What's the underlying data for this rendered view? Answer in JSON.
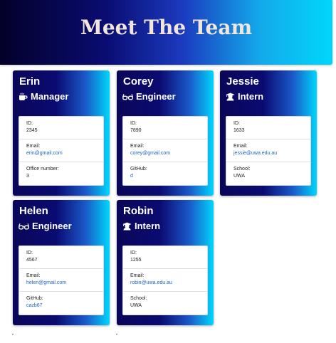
{
  "header": {
    "title": "Meet The Team"
  },
  "team": [
    {
      "name": "Erin",
      "role": "Manager",
      "role_icon": "coffee-icon",
      "rows": [
        {
          "label": "ID:",
          "value": "2345",
          "link": false
        },
        {
          "label": "Email:",
          "value": "erin@gmail.com",
          "link": true
        },
        {
          "label": "Office number:",
          "value": "3",
          "link": false
        }
      ]
    },
    {
      "name": "Corey",
      "role": "Engineer",
      "role_icon": "glasses-icon",
      "rows": [
        {
          "label": "ID:",
          "value": "7890",
          "link": false
        },
        {
          "label": "Email:",
          "value": "corey@gmail.com",
          "link": true
        },
        {
          "label": "GitHub:",
          "value": "d",
          "link": true
        }
      ]
    },
    {
      "name": "Jessie",
      "role": "Intern",
      "role_icon": "graduate-icon",
      "rows": [
        {
          "label": "ID:",
          "value": "1633",
          "link": false
        },
        {
          "label": "Email:",
          "value": "jessie@uwa.edu.au",
          "link": true
        },
        {
          "label": "School:",
          "value": "UWA",
          "link": false
        }
      ]
    },
    {
      "name": "Helen",
      "role": "Engineer",
      "role_icon": "glasses-icon",
      "rows": [
        {
          "label": "ID:",
          "value": "4567",
          "link": false
        },
        {
          "label": "Email:",
          "value": "helen@gmail.com",
          "link": true
        },
        {
          "label": "GitHub:",
          "value": "cazb67",
          "link": true
        }
      ]
    },
    {
      "name": "Robin",
      "role": "Intern",
      "role_icon": "graduate-icon",
      "rows": [
        {
          "label": "ID:",
          "value": "1255",
          "link": false
        },
        {
          "label": "Email:",
          "value": "robin@uwa.edu.au",
          "link": true
        },
        {
          "label": "School:",
          "value": "UWA",
          "link": false
        }
      ]
    }
  ]
}
